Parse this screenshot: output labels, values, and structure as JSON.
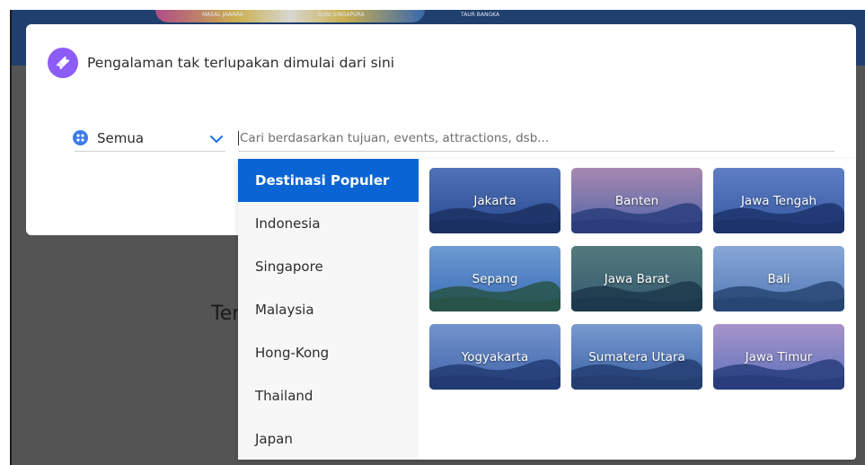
{
  "background": {
    "banner_texts": [
      "MASAL JAWARA",
      "SUWI SINGAPURA",
      "TAUR BANGKA"
    ],
    "partial_heading": "Ter"
  },
  "modal": {
    "title": "Pengalaman tak terlupakan dimulai dari sini",
    "badge_icon": "ticket-icon",
    "accent_color": "#8b5cf6"
  },
  "selector": {
    "icon": "globe-icon",
    "value": "Semua",
    "chevron_icon": "chevron-down-icon"
  },
  "search": {
    "placeholder": "Cari berdasarkan tujuan, events, attractions, dsb..."
  },
  "dropdown": {
    "active_color": "#0b64d4",
    "countries": [
      {
        "label": "Destinasi Populer",
        "active": true
      },
      {
        "label": "Indonesia",
        "active": false
      },
      {
        "label": "Singapore",
        "active": false
      },
      {
        "label": "Malaysia",
        "active": false
      },
      {
        "label": "Hong-Kong",
        "active": false
      },
      {
        "label": "Thailand",
        "active": false
      },
      {
        "label": "Japan",
        "active": false
      }
    ],
    "destinations": [
      {
        "label": "Jakarta"
      },
      {
        "label": "Banten"
      },
      {
        "label": "Jawa Tengah"
      },
      {
        "label": "Sepang"
      },
      {
        "label": "Jawa Barat"
      },
      {
        "label": "Bali"
      },
      {
        "label": "Yogyakarta"
      },
      {
        "label": "Sumatera Utara"
      },
      {
        "label": "Jawa Timur"
      }
    ]
  }
}
